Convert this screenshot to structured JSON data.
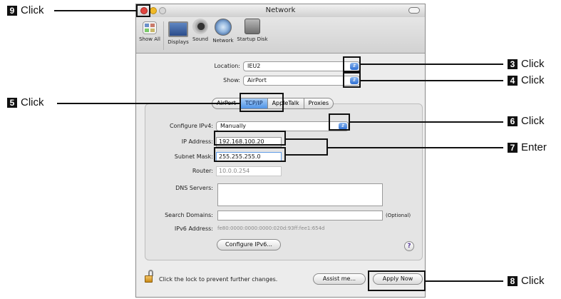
{
  "window": {
    "title": "Network"
  },
  "toolbar": {
    "items": [
      {
        "label": "Show All",
        "icon": "show-all-icon"
      },
      {
        "label": "Displays",
        "icon": "displays-icon"
      },
      {
        "label": "Sound",
        "icon": "sound-icon"
      },
      {
        "label": "Network",
        "icon": "network-icon"
      },
      {
        "label": "Startup Disk",
        "icon": "startup-disk-icon"
      }
    ]
  },
  "location": {
    "label": "Location:",
    "value": "IEU2"
  },
  "show": {
    "label": "Show:",
    "value": "AirPort"
  },
  "tabs": [
    "AirPort",
    "TCP/IP",
    "AppleTalk",
    "Proxies"
  ],
  "selected_tab": "TCP/IP",
  "configure": {
    "label": "Configure IPv4:",
    "value": "Manually"
  },
  "ip": {
    "label": "IP Address:",
    "value": "192.168.100.20"
  },
  "subnet": {
    "label": "Subnet Mask:",
    "value": "255.255.255.0"
  },
  "router": {
    "label": "Router:",
    "value": "10.0.0.254"
  },
  "dns": {
    "label": "DNS Servers:",
    "value": ""
  },
  "search": {
    "label": "Search Domains:",
    "value": "",
    "optional": "(Optional)"
  },
  "ipv6": {
    "label": "IPv6 Address:",
    "value": "fe80:0000:0000:0000:020d:93ff:fee1:654d"
  },
  "buttons": {
    "configure_ipv6": "Configure IPv6...",
    "assist": "Assist me...",
    "apply": "Apply Now",
    "help": "?"
  },
  "lock": {
    "text": "Click the lock to prevent further changes."
  },
  "callouts": [
    {
      "num": "9",
      "text": "Click"
    },
    {
      "num": "3",
      "text": "Click"
    },
    {
      "num": "4",
      "text": "Click"
    },
    {
      "num": "5",
      "text": "Click"
    },
    {
      "num": "6",
      "text": "Click"
    },
    {
      "num": "7",
      "text": "Enter"
    },
    {
      "num": "8",
      "text": "Click"
    }
  ],
  "colors": {
    "accent": "#3d85e0",
    "close": "#e0443e",
    "minimize": "#f0b928",
    "zoom": "#cfcfcf"
  }
}
